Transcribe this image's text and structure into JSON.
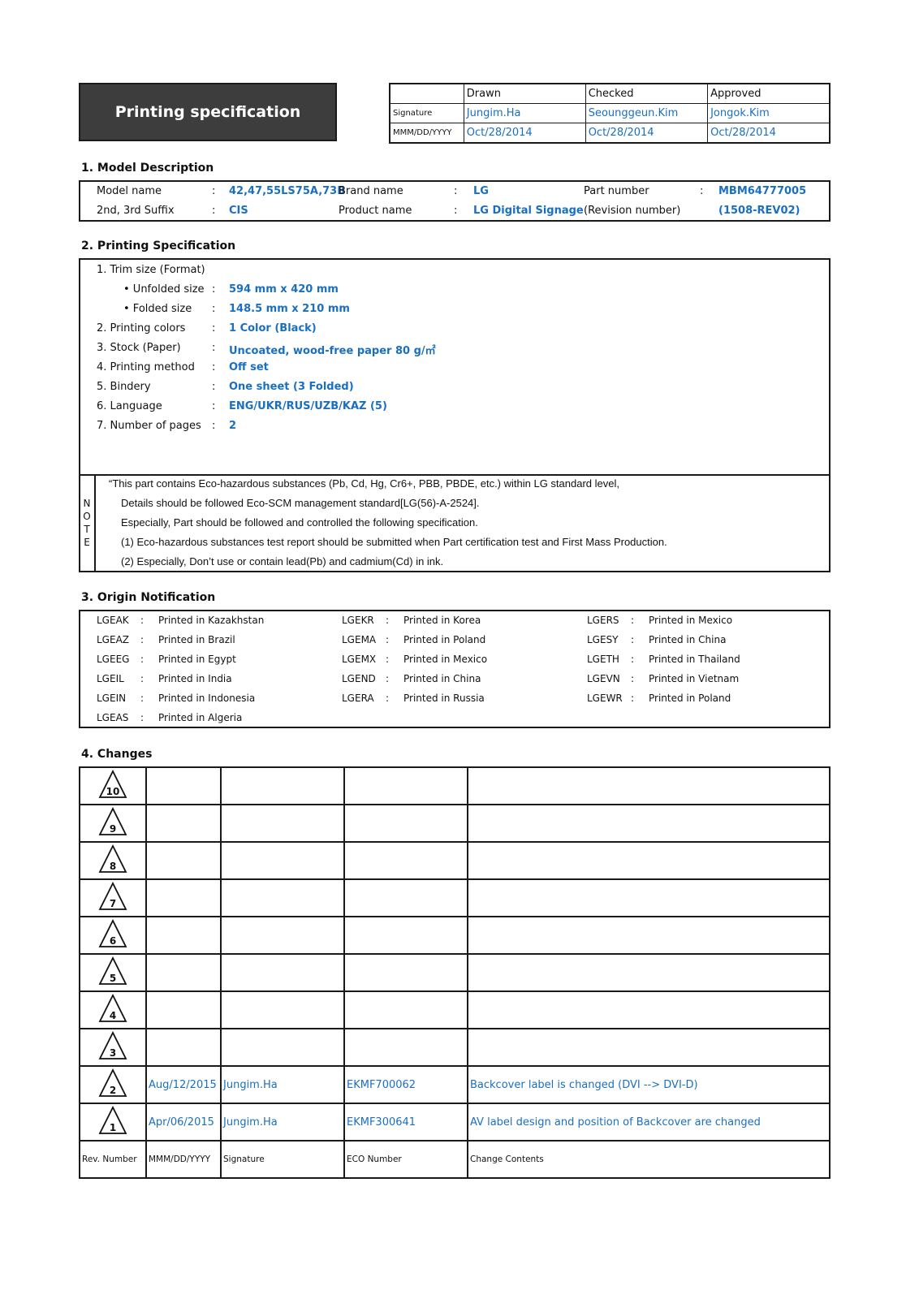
{
  "header": {
    "title": "Printing specification",
    "approval": {
      "columns": [
        "Drawn",
        "Checked",
        "Approved"
      ],
      "signature_label": "Signature",
      "date_label": "MMM/DD/YYYY",
      "signatures": [
        "Jungim.Ha",
        "Seounggeun.Kim",
        "Jongok.Kim"
      ],
      "dates": [
        "Oct/28/2014",
        "Oct/28/2014",
        "Oct/28/2014"
      ]
    }
  },
  "model_description": {
    "title": "1. Model Description",
    "model_name_label": "Model name",
    "model_name": "42,47,55LS75A,73B",
    "suffix_label": "2nd, 3rd Suffix",
    "suffix": "CIS",
    "brand_label": "Brand name",
    "brand": "LG",
    "product_label": "Product name",
    "product": "LG Digital Signage",
    "part_label": "Part number",
    "part": "MBM64777005",
    "revision_label": "(Revision number)",
    "revision": "(1508-REV02)",
    "colon": ":"
  },
  "printing_spec": {
    "title": "2. Printing Specification",
    "trim_label": "1. Trim size (Format)",
    "items": [
      {
        "label": "• Unfolded size",
        "value": "594 mm x 420 mm"
      },
      {
        "label": "• Folded size",
        "value": "148.5 mm x 210 mm"
      },
      {
        "label": "2. Printing colors",
        "value": "1 Color (Black)"
      },
      {
        "label": "3. Stock (Paper)",
        "value": "Uncoated, wood-free paper 80 g/㎡"
      },
      {
        "label": "4. Printing method",
        "value": "Off set"
      },
      {
        "label": "5. Bindery",
        "value": "One sheet (3 Folded)"
      },
      {
        "label": "6. Language",
        "value": "ENG/UKR/RUS/UZB/KAZ (5)"
      },
      {
        "label": "7. Number of pages",
        "value": "2"
      }
    ],
    "note": {
      "letters": [
        "N",
        "O",
        "T",
        "E"
      ],
      "lines": [
        "“This part contains Eco-hazardous substances (Pb, Cd, Hg, Cr6+, PBB, PBDE, etc.) within LG standard level,",
        "Details should be followed Eco-SCM management standard[LG(56)-A-2524].",
        "Especially, Part should be followed and controlled the following specification.",
        "(1) Eco-hazardous substances test report should be submitted when Part certification test and First Mass Production.",
        "(2) Especially, Don’t use or contain lead(Pb) and cadmium(Cd) in ink."
      ]
    }
  },
  "origin": {
    "title": "3. Origin Notification",
    "columns": [
      [
        {
          "code": "LGEAK",
          "text": "Printed in Kazakhstan"
        },
        {
          "code": "LGEAZ",
          "text": "Printed in Brazil"
        },
        {
          "code": "LGEEG",
          "text": "Printed in Egypt"
        },
        {
          "code": "LGEIL",
          "text": "Printed in India"
        },
        {
          "code": "LGEIN",
          "text": "Printed in Indonesia"
        },
        {
          "code": "LGEAS",
          "text": "Printed in Algeria"
        }
      ],
      [
        {
          "code": "LGEKR",
          "text": "Printed in Korea"
        },
        {
          "code": "LGEMA",
          "text": "Printed in Poland"
        },
        {
          "code": "LGEMX",
          "text": "Printed in Mexico"
        },
        {
          "code": "LGEND",
          "text": "Printed in China"
        },
        {
          "code": "LGERA",
          "text": "Printed in Russia"
        }
      ],
      [
        {
          "code": "LGERS",
          "text": "Printed in Mexico"
        },
        {
          "code": "LGESY",
          "text": "Printed in China"
        },
        {
          "code": "LGETH",
          "text": "Printed in Thailand"
        },
        {
          "code": "LGEVN",
          "text": "Printed in Vietnam"
        },
        {
          "code": "LGEWR",
          "text": "Printed in Poland"
        }
      ]
    ]
  },
  "changes": {
    "title": "4. Changes",
    "rows": [
      {
        "rev": "10",
        "date": "",
        "signature": "",
        "eco": "",
        "content": ""
      },
      {
        "rev": "9",
        "date": "",
        "signature": "",
        "eco": "",
        "content": ""
      },
      {
        "rev": "8",
        "date": "",
        "signature": "",
        "eco": "",
        "content": ""
      },
      {
        "rev": "7",
        "date": "",
        "signature": "",
        "eco": "",
        "content": ""
      },
      {
        "rev": "6",
        "date": "",
        "signature": "",
        "eco": "",
        "content": ""
      },
      {
        "rev": "5",
        "date": "",
        "signature": "",
        "eco": "",
        "content": ""
      },
      {
        "rev": "4",
        "date": "",
        "signature": "",
        "eco": "",
        "content": ""
      },
      {
        "rev": "3",
        "date": "",
        "signature": "",
        "eco": "",
        "content": ""
      },
      {
        "rev": "2",
        "date": "Aug/12/2015",
        "signature": "Jungim.Ha",
        "eco": "EKMF700062",
        "content": "Backcover label  is changed (DVI --> DVI-D)"
      },
      {
        "rev": "1",
        "date": "Apr/06/2015",
        "signature": "Jungim.Ha",
        "eco": "EKMF300641",
        "content": "AV label design and position of Backcover are changed"
      }
    ],
    "footer": [
      "Rev. Number",
      "MMM/DD/YYYY",
      "Signature",
      "ECO Number",
      "Change Contents"
    ]
  },
  "colors": {
    "accent_blue": "#1a6fc0",
    "title_bg": "#3d3d3d"
  }
}
